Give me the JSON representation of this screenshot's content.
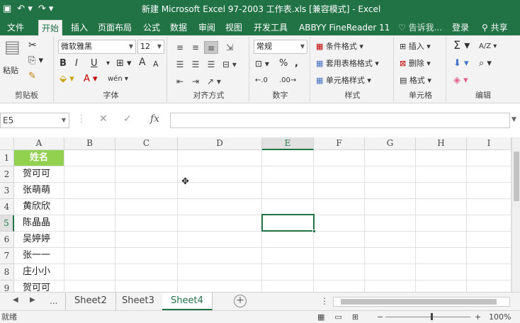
{
  "titlebar": {
    "save_icon": "save-icon",
    "undo_icon": "undo-icon",
    "redo_icon": "redo-icon",
    "title": "新建 Microsoft Excel 97-2003 工作表.xls  [兼容模式] - Excel"
  },
  "tabs": [
    "文件",
    "开始",
    "插入",
    "页面布局",
    "公式",
    "数据",
    "审阅",
    "视图",
    "开发工具",
    "ABBYY FineReader 11"
  ],
  "active_tab": "开始",
  "tell_me": "告诉我...",
  "login": "登录",
  "share": "共享",
  "ribbon": {
    "clipboard": {
      "paste": "粘贴",
      "label": "剪贴板"
    },
    "font": {
      "name": "微软雅黑",
      "size": "12",
      "bold": "B",
      "italic": "I",
      "underline": "U",
      "grow": "A",
      "shrink": "A",
      "label": "字体",
      "wen": "wén"
    },
    "align": {
      "label": "对齐方式"
    },
    "number": {
      "format": "常规",
      "label": "数字",
      "percent": "%",
      "comma": ","
    },
    "styles": {
      "cond": "条件格式",
      "table": "套用表格格式",
      "cell": "单元格样式",
      "label": "样式"
    },
    "cells": {
      "insert": "插入",
      "delete": "删除",
      "format": "格式",
      "label": "单元格"
    },
    "editing": {
      "label": "编辑",
      "sigma": "Σ",
      "sort": "A/Z"
    }
  },
  "formula": {
    "namebox": "E5",
    "fx": "fx",
    "cancel": "✕",
    "enter": "✓",
    "value": ""
  },
  "grid": {
    "columns": [
      "A",
      "B",
      "C",
      "D",
      "E",
      "F",
      "G",
      "H",
      "I"
    ],
    "rows": [
      "1",
      "2",
      "3",
      "4",
      "5",
      "6",
      "7",
      "8",
      "9"
    ],
    "selected_cell": "E5",
    "col_a_values": [
      "姓名",
      "贺可可",
      "张萌萌",
      "黄欣欣",
      "陈晶晶",
      "吴婷婷",
      "张一一",
      "庄小小",
      "贺可可"
    ]
  },
  "sheets": {
    "more": "...",
    "tabs": [
      "Sheet2",
      "Sheet3",
      "Sheet4"
    ],
    "active": "Sheet4",
    "add": "+"
  },
  "status": {
    "ready": "就绪",
    "zoom": "100%"
  },
  "colors": {
    "accent": "#217346",
    "header_fill": "#92d050"
  }
}
